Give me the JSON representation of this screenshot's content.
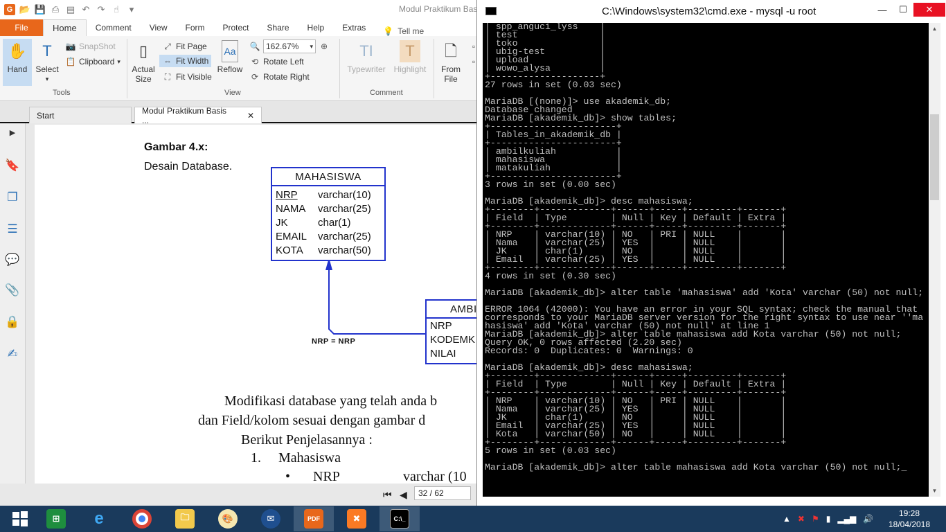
{
  "reader": {
    "doc_title": "Modul Praktikum Bas",
    "tabs": [
      "File",
      "Home",
      "Comment",
      "View",
      "Form",
      "Protect",
      "Share",
      "Help",
      "Extras"
    ],
    "tell_me": "Tell me",
    "tools": {
      "hand": "Hand",
      "select": "Select",
      "snapshot": "SnapShot",
      "clipboard": "Clipboard",
      "group": "Tools"
    },
    "view": {
      "actual_size": "Actual Size",
      "fit_page": "Fit Page",
      "fit_width": "Fit Width",
      "fit_visible": "Fit Visible",
      "reflow": "Reflow",
      "zoom": "162.67%",
      "rotate_left": "Rotate Left",
      "rotate_right": "Rotate Right",
      "group": "View"
    },
    "comment": {
      "typewriter": "Typewriter",
      "highlight": "Highlight",
      "group": "Comment"
    },
    "create": {
      "from_file": "From File"
    },
    "doc_tabs": [
      "Start",
      "Modul Praktikum Basis ..."
    ],
    "page_indicator": "32 / 62",
    "page": {
      "fig_title": "Gambar 4.x:",
      "fig_sub": "Desain Database.",
      "entity1": {
        "name": "MAHASISWA",
        "rows": [
          {
            "field": "NRP",
            "type": "varchar(10)"
          },
          {
            "field": "NAMA",
            "type": "varchar(25)"
          },
          {
            "field": "JK",
            "type": "char(1)"
          },
          {
            "field": "EMAIL",
            "type": "varchar(25)"
          },
          {
            "field": "KOTA",
            "type": "varchar(50)"
          }
        ]
      },
      "entity2": {
        "name": "AMBI",
        "rows": [
          "NRP",
          "KODEMK",
          "NILAI"
        ]
      },
      "relation": "NRP = NRP",
      "para1": "Modifikasi database yang telah anda b",
      "para2": "dan Field/kolom sesuai dengan gambar d",
      "para3": "Berikut Penjelasannya :",
      "list_num": "1.",
      "list_item": "Mahasiswa",
      "bullet": "•",
      "bullet_field": "NRP",
      "bullet_type": "varchar (10"
    }
  },
  "cmd": {
    "title": "C:\\Windows\\system32\\cmd.exe - mysql  -u root",
    "minimize": "—",
    "maximize": "☐",
    "close": "✕",
    "console_text": "| spp_anguci_lyss    |\n| test               |\n| toko               |\n| ubig-test          |\n| upload             |\n| wowo_alysa         |\n+--------------------+\n27 rows in set (0.03 sec)\n\nMariaDB [(none)]> use akademik_db;\nDatabase changed\nMariaDB [akademik_db]> show tables;\n+-----------------------+\n| Tables_in_akademik_db |\n+-----------------------+\n| ambilkuliah           |\n| mahasiswa             |\n| matakuliah            |\n+-----------------------+\n3 rows in set (0.00 sec)\n\nMariaDB [akademik_db]> desc mahasiswa;\n+--------+-------------+------+-----+---------+-------+\n| Field  | Type        | Null | Key | Default | Extra |\n+--------+-------------+------+-----+---------+-------+\n| NRP    | varchar(10) | NO   | PRI | NULL    |       |\n| Nama   | varchar(25) | YES  |     | NULL    |       |\n| JK     | char(1)     | NO   |     | NULL    |       |\n| Email  | varchar(25) | YES  |     | NULL    |       |\n+--------+-------------+------+-----+---------+-------+\n4 rows in set (0.30 sec)\n\nMariaDB [akademik_db]> alter table 'mahasiswa' add 'Kota' varchar (50) not null;\n\nERROR 1064 (42000): You have an error in your SQL syntax; check the manual that\ncorresponds to your MariaDB server version for the right syntax to use near ''ma\nhasiswa' add 'Kota' varchar (50) not null' at line 1\nMariaDB [akademik_db]> alter table mahasiswa add Kota varchar (50) not null;\nQuery OK, 0 rows affected (2.20 sec)\nRecords: 0  Duplicates: 0  Warnings: 0\n\nMariaDB [akademik_db]> desc mahasiswa;\n+--------+-------------+------+-----+---------+-------+\n| Field  | Type        | Null | Key | Default | Extra |\n+--------+-------------+------+-----+---------+-------+\n| NRP    | varchar(10) | NO   | PRI | NULL    |       |\n| Nama   | varchar(25) | YES  |     | NULL    |       |\n| JK     | char(1)     | NO   |     | NULL    |       |\n| Email  | varchar(25) | YES  |     | NULL    |       |\n| Kota   | varchar(50) | NO   |     | NULL    |       |\n+--------+-------------+------+-----+---------+-------+\n5 rows in set (0.03 sec)\n\nMariaDB [akademik_db]> alter table mahasiswa add Kota varchar (50) not null;_"
  },
  "taskbar": {
    "clock_time": "19:28",
    "clock_date": "18/04/2018",
    "pdf_label": "PDF"
  },
  "colors": {
    "accent_orange": "#e8671b",
    "erd_blue": "#2233cc",
    "taskbar": "#1a3a5c",
    "console_bg": "#000000",
    "console_fg": "#c0c0c0"
  }
}
